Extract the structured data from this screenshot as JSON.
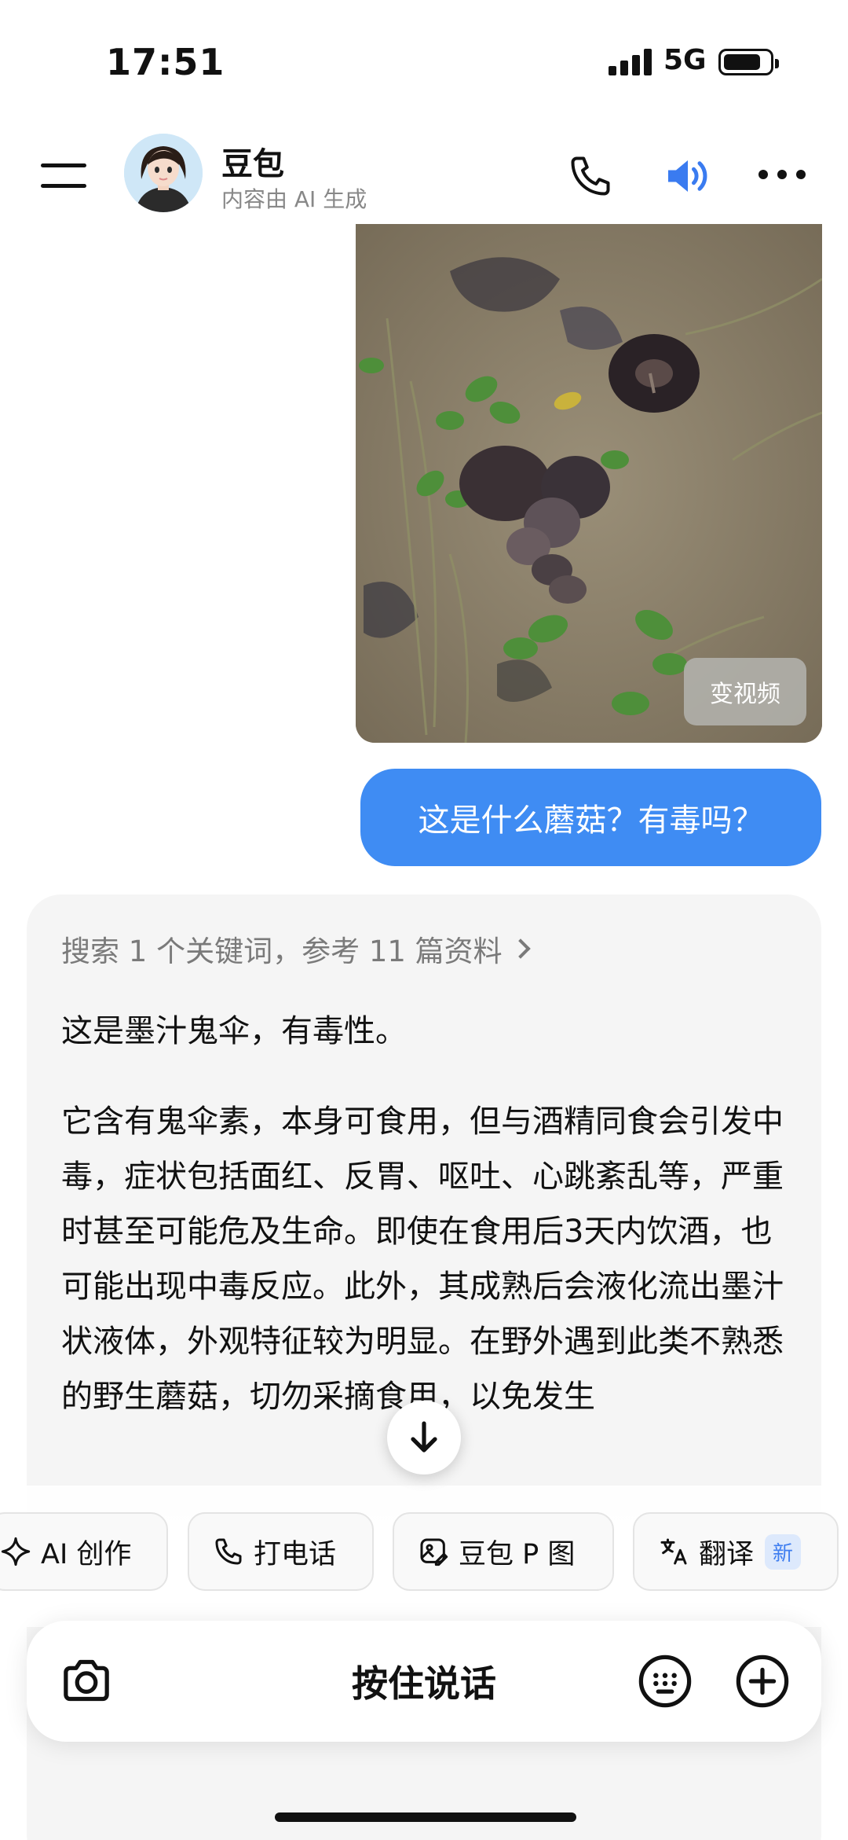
{
  "status_bar": {
    "time": "17:51",
    "network": "5G"
  },
  "header": {
    "title": "豆包",
    "subtitle": "内容由 AI 生成"
  },
  "photo": {
    "overlay_button": "变视频"
  },
  "user_message": "这是什么蘑菇？有毒吗？",
  "reply": {
    "search_summary": "搜索 1 个关键词，参考 11 篇资料",
    "line1": "这是墨汁鬼伞，有毒性。",
    "paragraph": "它含有鬼伞素，本身可食用，但与酒精同食会引发中毒，症状包括面红、反胃、呕吐、心跳紊乱等，严重时甚至可能危及生命。即使在食用后3天内饮酒，也可能出现中毒反应。此外，其成熟后会液化流出墨汁状液体，外观特征较为明显。在野外遇到此类不熟悉的野生蘑菇，切勿采摘食用，以免发生"
  },
  "quick_actions": [
    {
      "label": "AI 创作",
      "icon": "sparkle-icon"
    },
    {
      "label": "打电话",
      "icon": "phone-icon"
    },
    {
      "label": "豆包 P 图",
      "icon": "image-edit-icon"
    },
    {
      "label": "翻译",
      "icon": "translate-icon",
      "badge": "新"
    }
  ],
  "input": {
    "hold_to_talk": "按住说话"
  },
  "colors": {
    "accent": "#3f8cf3",
    "badge": "#3f7ef0"
  }
}
